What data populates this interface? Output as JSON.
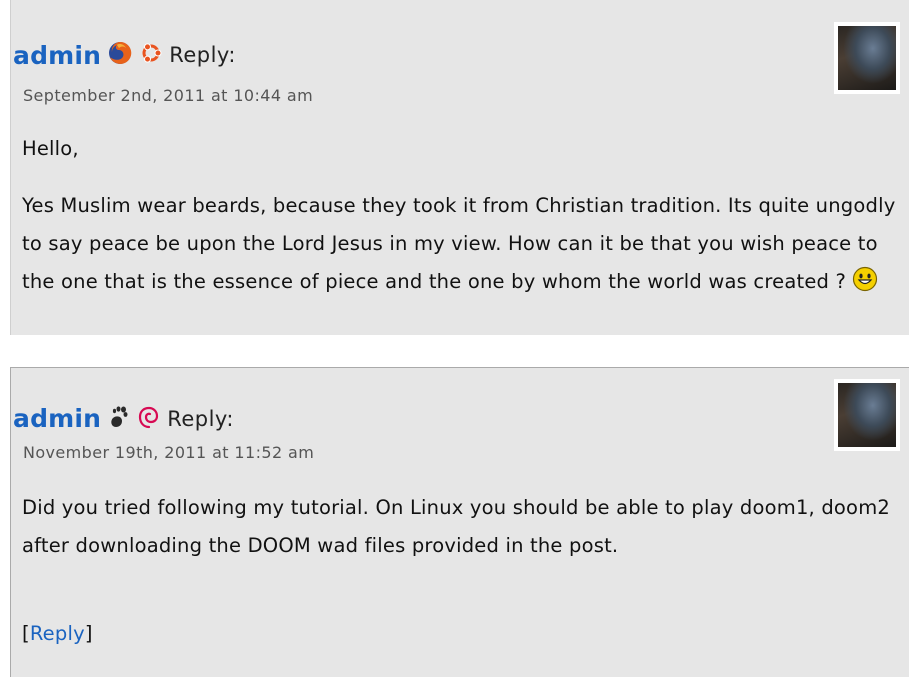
{
  "comments": [
    {
      "author": "admin",
      "reply_label": "Reply:",
      "date": "September 2nd, 2011 at 10:44 am",
      "icons": [
        "firefox-icon",
        "ubuntu-icon"
      ],
      "paragraphs": [
        "Hello,",
        "Yes Muslim wear beards, because they took it from Christian tradition. Its quite ungodly to say peace be upon the Lord Jesus in my view. How can it be that you wish peace to the one that is the essence of piece and the one by whom the world was created ?"
      ],
      "emoticon": "smiley-icon"
    },
    {
      "author": "admin",
      "reply_label": "Reply:",
      "date": "November 19th, 2011 at 11:52 am",
      "icons": [
        "gnome-icon",
        "debian-icon"
      ],
      "paragraphs": [
        "Did you tried following my tutorial. On Linux you should be able to play doom1, doom2 after downloading the DOOM wad files provided in the post."
      ],
      "reply_link": {
        "open": "[",
        "label": "Reply",
        "close": "]"
      }
    }
  ],
  "colors": {
    "link": "#1a63c0",
    "background": "#e6e6e6"
  }
}
